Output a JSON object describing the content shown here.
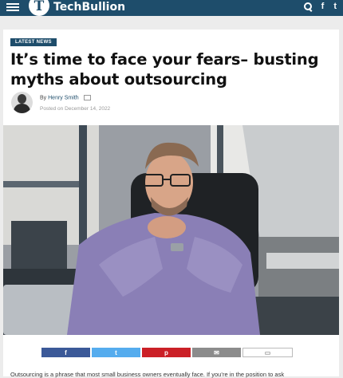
{
  "header": {
    "logo_letter": "T",
    "logo_text": "TechBullion",
    "icons": [
      "menu-icon",
      "search-icon",
      "facebook-icon",
      "twitter-icon"
    ],
    "facebook_glyph": "f",
    "twitter_glyph": "t"
  },
  "article": {
    "badge": "LATEST NEWS",
    "title": "It’s time to face your fears– busting myths about outsourcing",
    "by_label": "By",
    "author": "Henry Smith",
    "posted": "Posted on December 14, 2022",
    "intro": "Outsourcing is a phrase that most small business owners eventually face. If you’re in the position to ask"
  },
  "share": {
    "facebook": "f",
    "twitter": "t",
    "pinterest": "p",
    "email": "✉",
    "comment": "▭"
  },
  "colors": {
    "brand": "#1e4d6b",
    "facebook": "#3b5998",
    "twitter": "#55acee",
    "pinterest": "#cb2027",
    "email": "#8c8c8c"
  }
}
